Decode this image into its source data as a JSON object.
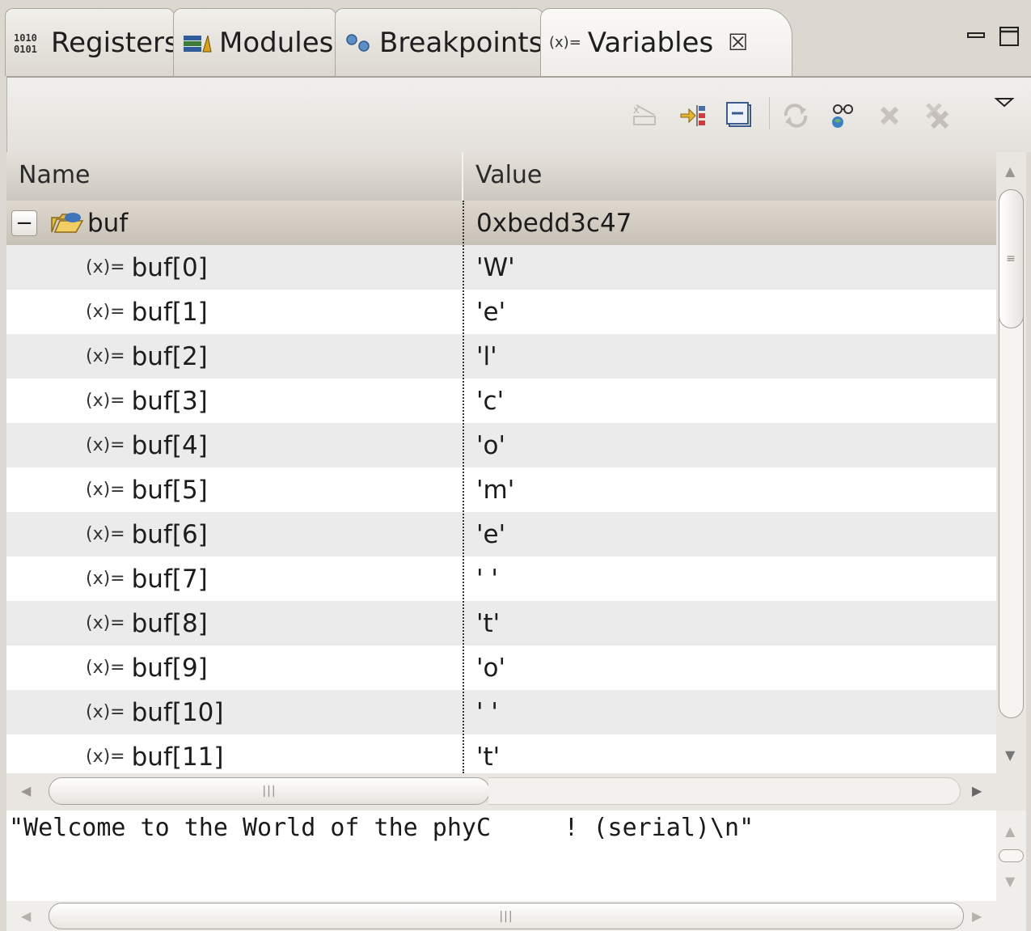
{
  "tabs": [
    {
      "label": "Registers",
      "icon": "registers-icon",
      "icon_glyph": "1010\n0101"
    },
    {
      "label": "Modules",
      "icon": "modules-icon"
    },
    {
      "label": "Breakpoints",
      "icon": "breakpoints-icon"
    },
    {
      "label": "Variables",
      "icon": "variables-icon",
      "icon_glyph": "(x)=",
      "active": true,
      "close_glyph": "☒"
    }
  ],
  "window_controls": {
    "minimize": "minimize-icon",
    "maximize": "maximize-icon"
  },
  "toolbar": {
    "buttons": [
      "show-type-names-icon",
      "show-logical-structure-icon",
      "collapse-all-icon",
      "refresh-icon",
      "add-watch-expression-icon",
      "remove-icon",
      "remove-all-icon"
    ],
    "view_menu": "view-menu-icon"
  },
  "table": {
    "columns": [
      "Name",
      "Value"
    ],
    "root": {
      "name": "buf",
      "value": "0xbedd3c47",
      "expanded": true,
      "expander_glyph": "−"
    },
    "var_glyph": "(x)=",
    "rows": [
      {
        "name": "buf[0]",
        "value": "'W'"
      },
      {
        "name": "buf[1]",
        "value": "'e'"
      },
      {
        "name": "buf[2]",
        "value": "'l'"
      },
      {
        "name": "buf[3]",
        "value": "'c'"
      },
      {
        "name": "buf[4]",
        "value": "'o'"
      },
      {
        "name": "buf[5]",
        "value": "'m'"
      },
      {
        "name": "buf[6]",
        "value": "'e'"
      },
      {
        "name": "buf[7]",
        "value": "' '"
      },
      {
        "name": "buf[8]",
        "value": "'t'"
      },
      {
        "name": "buf[9]",
        "value": "'o'"
      },
      {
        "name": "buf[10]",
        "value": "' '"
      },
      {
        "name": "buf[11]",
        "value": "'t'"
      }
    ]
  },
  "details": {
    "text": "\"Welcome to the World of the phyC     ! (serial)\\n\""
  },
  "scroll": {
    "grip": "|||",
    "grip_h": "≡",
    "up": "▲",
    "down": "▼",
    "left": "◀",
    "right": "▶"
  },
  "colors": {
    "selected_row": "#cfc8bd",
    "alt_row": "#ebebeb",
    "header": "#d6d2ca",
    "background": "#dedad3"
  }
}
